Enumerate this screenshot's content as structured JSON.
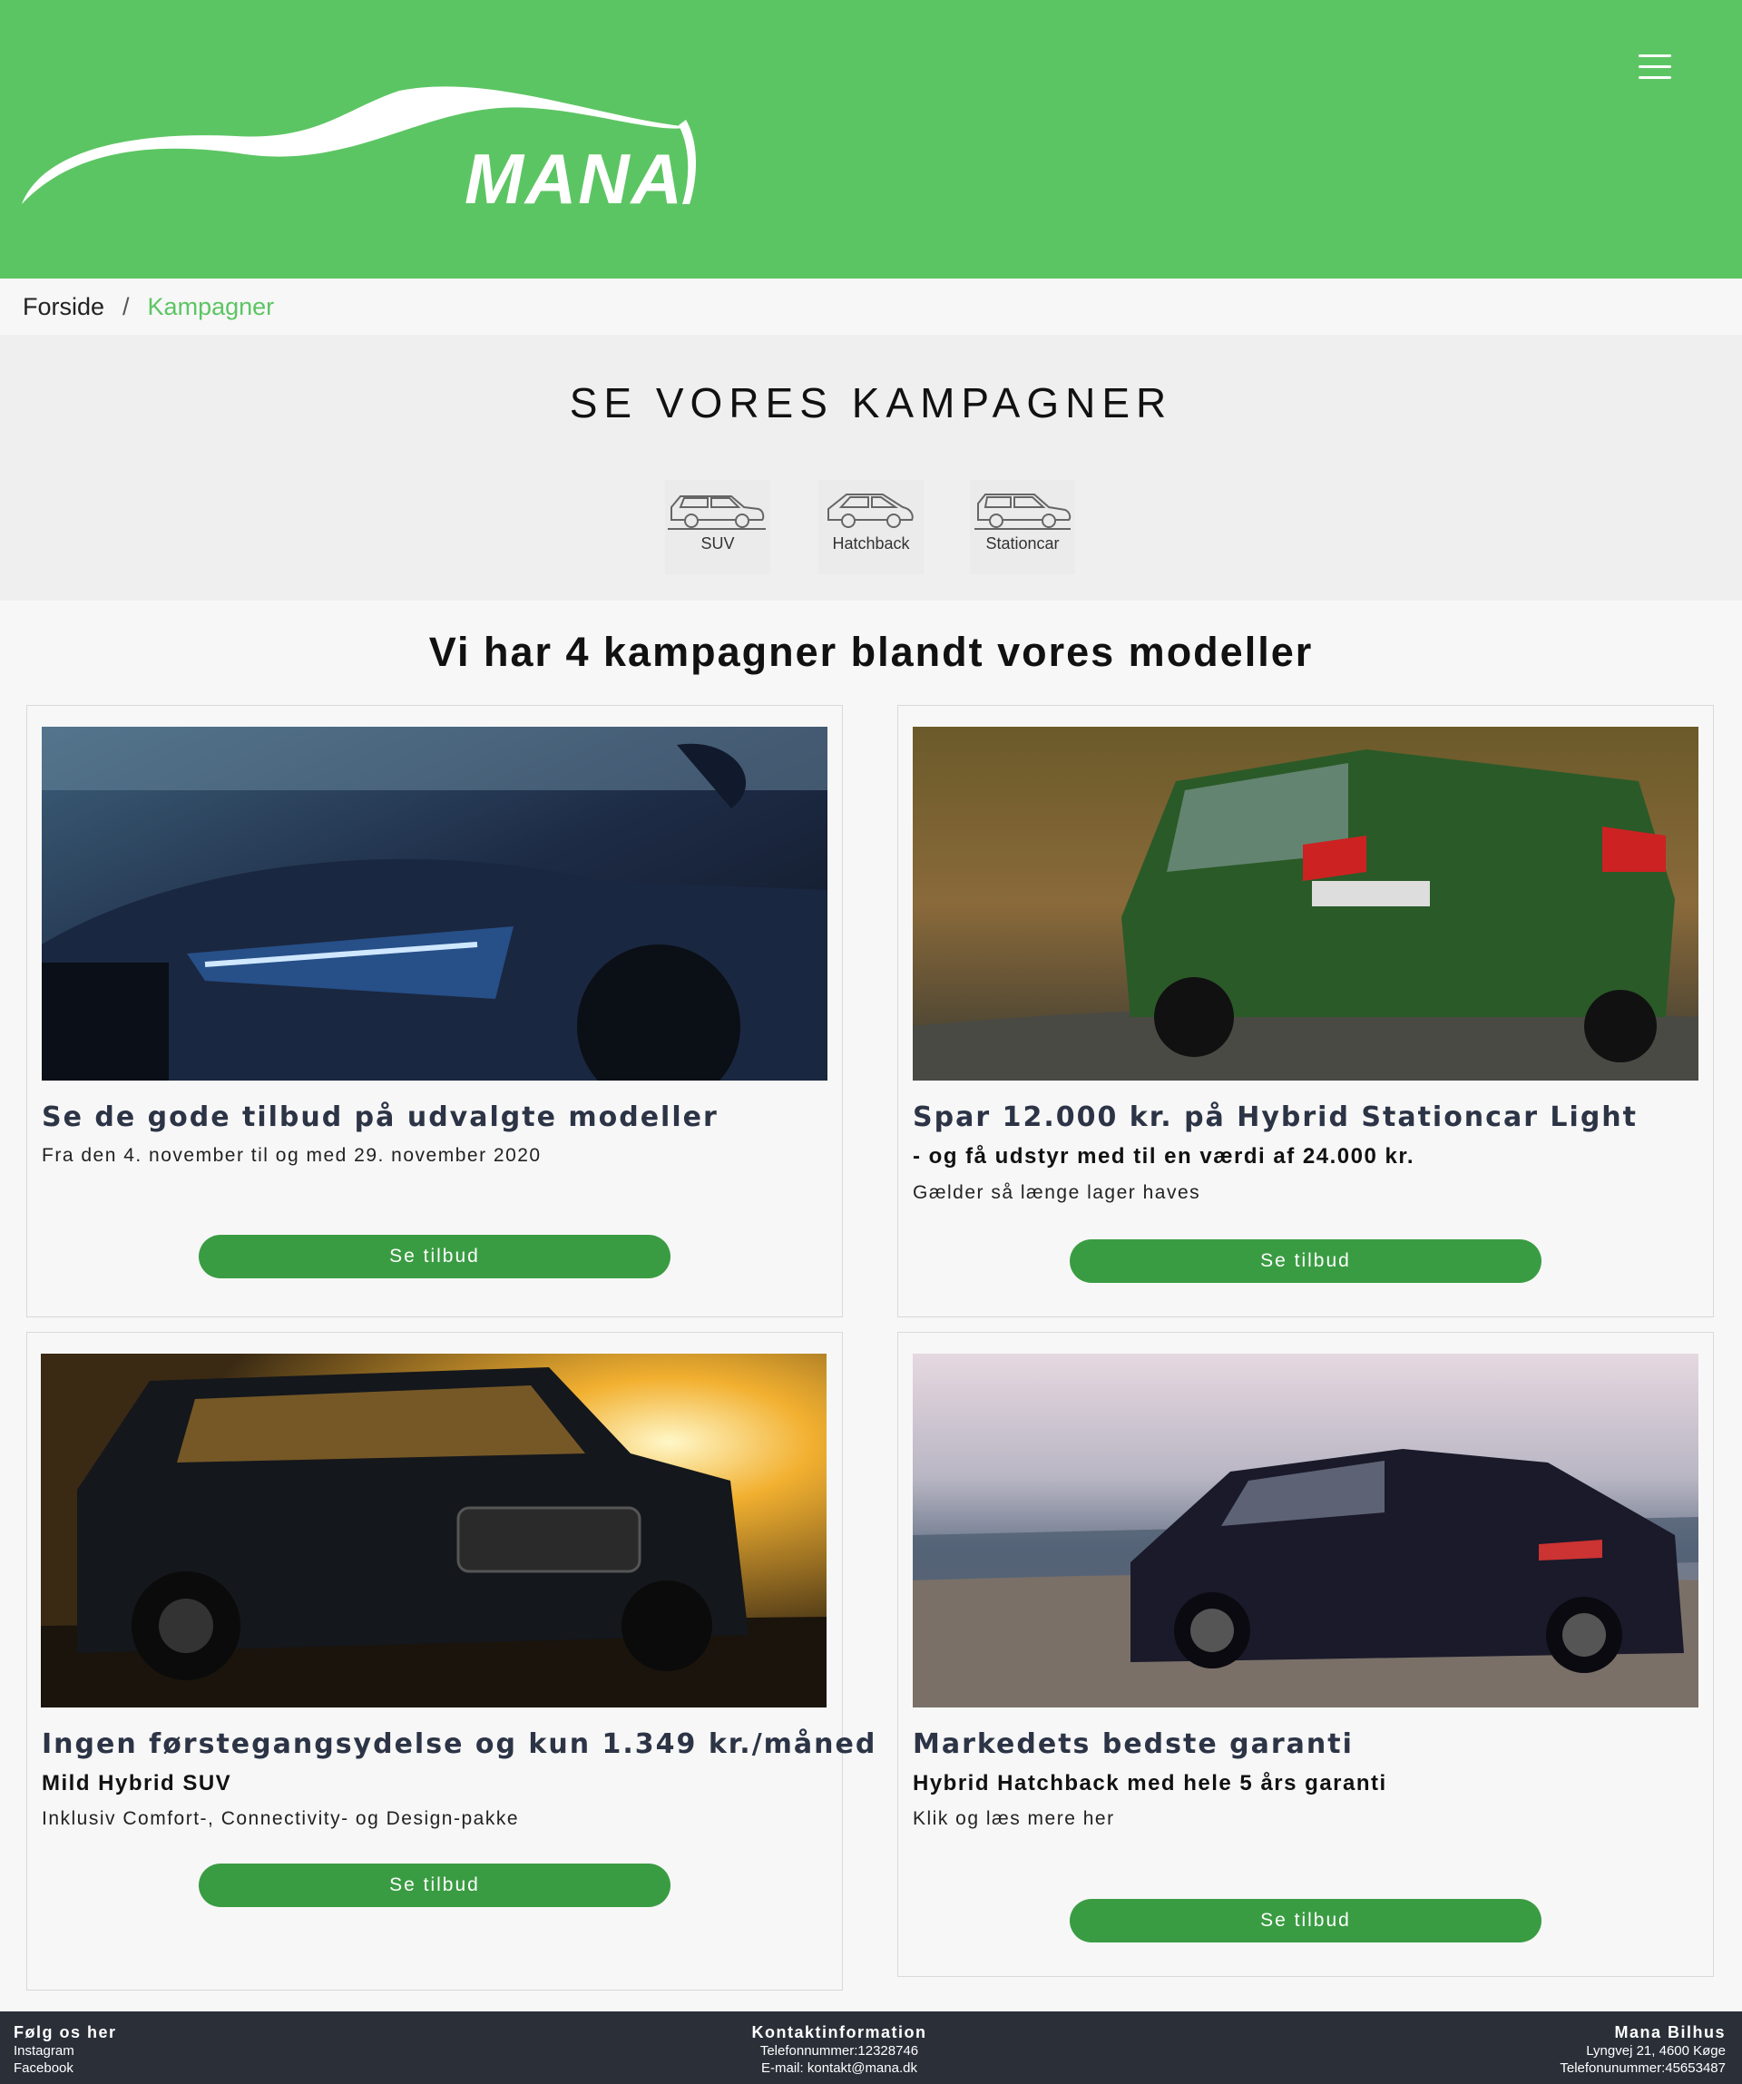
{
  "header": {
    "logo_text": "MANA",
    "brand_color": "#5cc563",
    "menu_icon": "hamburger-menu-icon"
  },
  "breadcrumb": {
    "home": "Forside",
    "separator": "/",
    "current": "Kampagner"
  },
  "hero": {
    "title": "SE VORES KAMPAGNER",
    "categories": [
      {
        "label": "SUV",
        "icon": "suv-car-icon"
      },
      {
        "label": "Hatchback",
        "icon": "hatchback-car-icon"
      },
      {
        "label": "Stationcar",
        "icon": "stationcar-car-icon"
      }
    ]
  },
  "subtitle": "Vi har 4 kampagner blandt vores modeller",
  "cards": [
    {
      "title": "Se de gode tilbud på udvalgte modeller",
      "subtitle": "",
      "text": "Fra den 4. november til og med 29. november 2020",
      "button": "Se tilbud"
    },
    {
      "title": "Spar 12.000 kr. på Hybrid Stationcar Light",
      "subtitle": "- og få udstyr med til en værdi af 24.000 kr.",
      "text": "Gælder så længe lager haves",
      "button": "Se tilbud"
    },
    {
      "title": "Ingen førstegangsydelse og kun 1.349 kr./måned",
      "subtitle": "Mild Hybrid SUV",
      "text": "Inklusiv Comfort-, Connectivity- og Design-pakke",
      "button": "Se tilbud"
    },
    {
      "title": "Markedets bedste garanti",
      "subtitle": "Hybrid Hatchback med hele 5 års garanti",
      "text": "Klik og læs mere her",
      "button": "Se tilbud"
    }
  ],
  "footer": {
    "follow": {
      "title": "Følg os her",
      "links": [
        "Instagram",
        "Facebook"
      ]
    },
    "contact": {
      "title": "Kontaktinformation",
      "phone": "Telefonnummer:12328746",
      "email": "E-mail: kontakt@mana.dk"
    },
    "company": {
      "title": "Mana Bilhus",
      "address": "Lyngvej 21, 4600 Køge",
      "phone": "Telefonunummer:45653487"
    }
  },
  "colors": {
    "button": "#3a9c42",
    "footer": "#2a2f38",
    "card_title": "#2c3446"
  }
}
